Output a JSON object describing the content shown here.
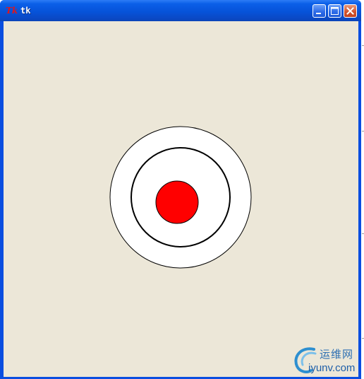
{
  "window": {
    "title": "tk",
    "logo_text": "Tk",
    "buttons": [
      {
        "icon": "minimize-icon"
      },
      {
        "icon": "maximize-icon"
      },
      {
        "icon": "close-icon"
      }
    ]
  },
  "canvas": {
    "background": "#ece7d8",
    "shapes": [
      {
        "name": "outer-circle",
        "fill": "#ffffff",
        "stroke": "#000000"
      },
      {
        "name": "middle-ring",
        "fill": "#ffffff",
        "stroke": "#000000"
      },
      {
        "name": "center-dot",
        "fill": "#ff0000",
        "stroke": "#000000"
      }
    ]
  },
  "watermark": {
    "chinese": "运维网",
    "site": "iyunv.com"
  },
  "colors": {
    "titlebar": "#0653d9",
    "close_button": "#d3552f",
    "accent_red": "#ff0000"
  }
}
